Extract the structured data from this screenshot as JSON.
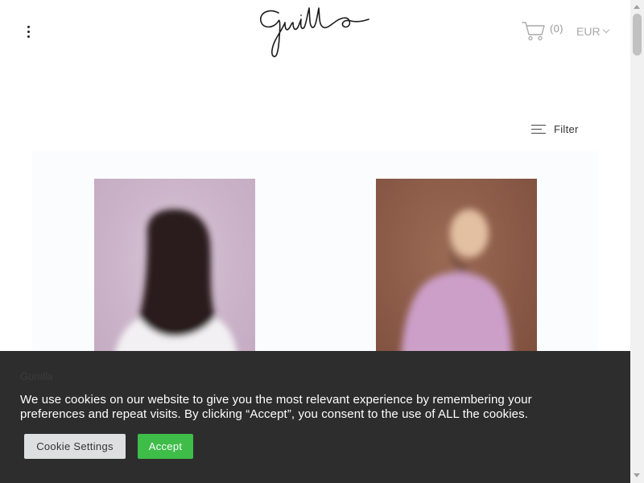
{
  "header": {
    "brand": "gunilla",
    "menu_icon": "more-vertical-icon",
    "cart": {
      "icon": "cart-icon",
      "count": "(0)"
    },
    "currency": {
      "selected": "EUR",
      "icon": "chevron-down-icon"
    }
  },
  "filter": {
    "icon": "filter-lines-icon",
    "label": "Filter"
  },
  "products": [
    {
      "name": "artwork-woman-dark-hair",
      "colors": {
        "bg": "#c9b3c8",
        "hair": "#2a1a1f",
        "shirt": "#f2f0f2"
      }
    },
    {
      "name": "artwork-figure-lilac-sweater",
      "colors": {
        "bg": "#8b5a46",
        "face": "#e3c0a2",
        "sweater": "#cc9fc9"
      }
    }
  ],
  "cookie_banner": {
    "brand_watermark": "Gunilla",
    "message": "We use cookies on our website to give you the most relevant experience by remembering your preferences and repeat visits. By clicking “Accept”, you consent to the use of ALL the cookies.",
    "settings_label": "Cookie Settings",
    "accept_label": "Accept",
    "colors": {
      "background": "#2d2d2d",
      "accept": "#3ebd49",
      "settings": "#dedfe0"
    }
  }
}
